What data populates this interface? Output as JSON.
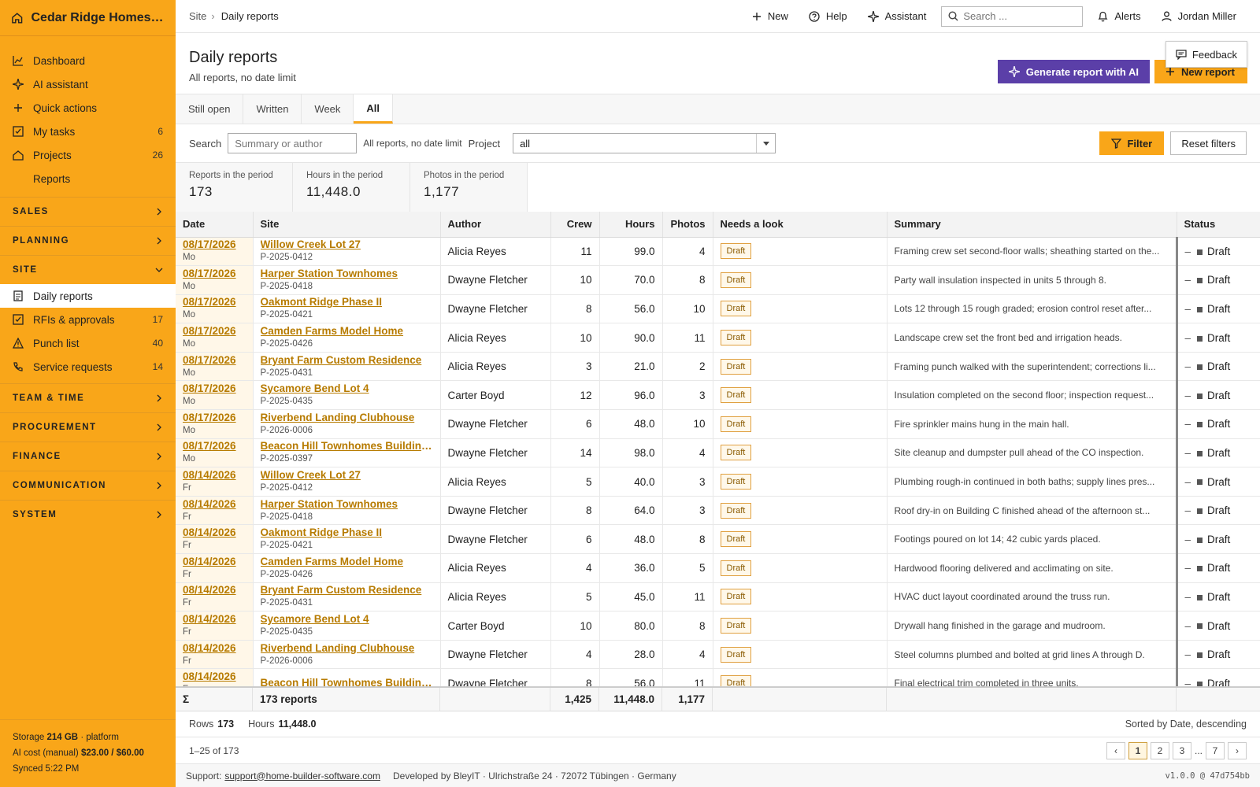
{
  "brand": {
    "name": "Cedar Ridge Homes LLC"
  },
  "nav": [
    {
      "label": "Dashboard",
      "count": "",
      "icon": "chart-icon"
    },
    {
      "label": "AI assistant",
      "count": "",
      "icon": "sparkle-icon"
    },
    {
      "label": "Quick actions",
      "count": "",
      "icon": "plus-icon"
    },
    {
      "label": "My tasks",
      "count": "6",
      "icon": "checkbox-icon"
    },
    {
      "label": "Projects",
      "count": "26",
      "icon": "house-icon"
    },
    {
      "label": "Reports",
      "count": "",
      "icon": "none"
    }
  ],
  "sections": {
    "sales": "SALES",
    "planning": "PLANNING",
    "site": "SITE",
    "team": "TEAM & TIME",
    "procurement": "PROCUREMENT",
    "finance": "FINANCE",
    "communication": "COMMUNICATION",
    "system": "SYSTEM"
  },
  "site_items": [
    {
      "label": "Daily reports",
      "count": ""
    },
    {
      "label": "RFIs & approvals",
      "count": "17"
    },
    {
      "label": "Punch list",
      "count": "40"
    },
    {
      "label": "Service requests",
      "count": "14"
    }
  ],
  "sidebar_footer": {
    "storage_label": "Storage",
    "storage_value": "214 GB",
    "storage_suffix": "· platform",
    "ai_label": "AI cost (manual)",
    "ai_value": "$23.00 / $60.00",
    "synced": "Synced 5:22 PM"
  },
  "topbar": {
    "crumb_root": "Site",
    "crumb_sep": "›",
    "crumb_current": "Daily reports",
    "new": "New",
    "help": "Help",
    "assistant": "Assistant",
    "search_placeholder": "Search ...",
    "alerts": "Alerts",
    "user": "Jordan Miller"
  },
  "header": {
    "title": "Daily reports",
    "subtitle": "All reports, no date limit",
    "feedback": "Feedback",
    "generate_ai": "Generate report with AI",
    "new_report": "New report"
  },
  "tabs": [
    "Still open",
    "Written",
    "Week",
    "All"
  ],
  "filters": {
    "search_label": "Search",
    "search_placeholder": "Summary or author",
    "note": "All reports, no date limit",
    "project_label": "Project",
    "project_value": "all",
    "filter_btn": "Filter",
    "reset_btn": "Reset filters"
  },
  "stats": [
    {
      "label": "Reports in the period",
      "value": "173"
    },
    {
      "label": "Hours in the period",
      "value": "11,448.0"
    },
    {
      "label": "Photos in the period",
      "value": "1,177"
    }
  ],
  "columns": [
    "Date",
    "Site",
    "Author",
    "Crew",
    "Hours",
    "Photos",
    "Needs a look",
    "Summary",
    "Status"
  ],
  "rows": [
    {
      "date": "08/17/2026",
      "day": "Mo",
      "site": "Willow Creek Lot 27",
      "code": "P-2025-0412",
      "author": "Alicia Reyes",
      "crew": "11",
      "hours": "99.0",
      "photos": "4",
      "badge": "Draft",
      "summary": "Framing crew set second-floor walls; sheathing started on the...",
      "status": "Draft"
    },
    {
      "date": "08/17/2026",
      "day": "Mo",
      "site": "Harper Station Townhomes",
      "code": "P-2025-0418",
      "author": "Dwayne Fletcher",
      "crew": "10",
      "hours": "70.0",
      "photos": "8",
      "badge": "Draft",
      "summary": "Party wall insulation inspected in units 5 through 8.",
      "status": "Draft"
    },
    {
      "date": "08/17/2026",
      "day": "Mo",
      "site": "Oakmont Ridge Phase II",
      "code": "P-2025-0421",
      "author": "Dwayne Fletcher",
      "crew": "8",
      "hours": "56.0",
      "photos": "10",
      "badge": "Draft",
      "summary": "Lots 12 through 15 rough graded; erosion control reset after...",
      "status": "Draft"
    },
    {
      "date": "08/17/2026",
      "day": "Mo",
      "site": "Camden Farms Model Home",
      "code": "P-2025-0426",
      "author": "Alicia Reyes",
      "crew": "10",
      "hours": "90.0",
      "photos": "11",
      "badge": "Draft",
      "summary": "Landscape crew set the front bed and irrigation heads.",
      "status": "Draft"
    },
    {
      "date": "08/17/2026",
      "day": "Mo",
      "site": "Bryant Farm Custom Residence",
      "code": "P-2025-0431",
      "author": "Alicia Reyes",
      "crew": "3",
      "hours": "21.0",
      "photos": "2",
      "badge": "Draft",
      "summary": "Framing punch walked with the superintendent; corrections li...",
      "status": "Draft"
    },
    {
      "date": "08/17/2026",
      "day": "Mo",
      "site": "Sycamore Bend Lot 4",
      "code": "P-2025-0435",
      "author": "Carter Boyd",
      "crew": "12",
      "hours": "96.0",
      "photos": "3",
      "badge": "Draft",
      "summary": "Insulation completed on the second floor; inspection request...",
      "status": "Draft"
    },
    {
      "date": "08/17/2026",
      "day": "Mo",
      "site": "Riverbend Landing Clubhouse",
      "code": "P-2026-0006",
      "author": "Dwayne Fletcher",
      "crew": "6",
      "hours": "48.0",
      "photos": "10",
      "badge": "Draft",
      "summary": "Fire sprinkler mains hung in the main hall.",
      "status": "Draft"
    },
    {
      "date": "08/17/2026",
      "day": "Mo",
      "site": "Beacon Hill Townhomes Building C",
      "code": "P-2025-0397",
      "author": "Dwayne Fletcher",
      "crew": "14",
      "hours": "98.0",
      "photos": "4",
      "badge": "Draft",
      "summary": "Site cleanup and dumpster pull ahead of the CO inspection.",
      "status": "Draft"
    },
    {
      "date": "08/14/2026",
      "day": "Fr",
      "site": "Willow Creek Lot 27",
      "code": "P-2025-0412",
      "author": "Alicia Reyes",
      "crew": "5",
      "hours": "40.0",
      "photos": "3",
      "badge": "Draft",
      "summary": "Plumbing rough-in continued in both baths; supply lines pres...",
      "status": "Draft"
    },
    {
      "date": "08/14/2026",
      "day": "Fr",
      "site": "Harper Station Townhomes",
      "code": "P-2025-0418",
      "author": "Dwayne Fletcher",
      "crew": "8",
      "hours": "64.0",
      "photos": "3",
      "badge": "Draft",
      "summary": "Roof dry-in on Building C finished ahead of the afternoon st...",
      "status": "Draft"
    },
    {
      "date": "08/14/2026",
      "day": "Fr",
      "site": "Oakmont Ridge Phase II",
      "code": "P-2025-0421",
      "author": "Dwayne Fletcher",
      "crew": "6",
      "hours": "48.0",
      "photos": "8",
      "badge": "Draft",
      "summary": "Footings poured on lot 14; 42 cubic yards placed.",
      "status": "Draft"
    },
    {
      "date": "08/14/2026",
      "day": "Fr",
      "site": "Camden Farms Model Home",
      "code": "P-2025-0426",
      "author": "Alicia Reyes",
      "crew": "4",
      "hours": "36.0",
      "photos": "5",
      "badge": "Draft",
      "summary": "Hardwood flooring delivered and acclimating on site.",
      "status": "Draft"
    },
    {
      "date": "08/14/2026",
      "day": "Fr",
      "site": "Bryant Farm Custom Residence",
      "code": "P-2025-0431",
      "author": "Alicia Reyes",
      "crew": "5",
      "hours": "45.0",
      "photos": "11",
      "badge": "Draft",
      "summary": "HVAC duct layout coordinated around the truss run.",
      "status": "Draft"
    },
    {
      "date": "08/14/2026",
      "day": "Fr",
      "site": "Sycamore Bend Lot 4",
      "code": "P-2025-0435",
      "author": "Carter Boyd",
      "crew": "10",
      "hours": "80.0",
      "photos": "8",
      "badge": "Draft",
      "summary": "Drywall hang finished in the garage and mudroom.",
      "status": "Draft"
    },
    {
      "date": "08/14/2026",
      "day": "Fr",
      "site": "Riverbend Landing Clubhouse",
      "code": "P-2026-0006",
      "author": "Dwayne Fletcher",
      "crew": "4",
      "hours": "28.0",
      "photos": "4",
      "badge": "Draft",
      "summary": "Steel columns plumbed and bolted at grid lines A through D.",
      "status": "Draft"
    },
    {
      "date": "08/14/2026",
      "day": "Fr",
      "site": "Beacon Hill Townhomes Building C",
      "code": "",
      "author": "Dwayne Fletcher",
      "crew": "8",
      "hours": "56.0",
      "photos": "11",
      "badge": "Draft",
      "summary": "Final electrical trim completed in three units.",
      "status": "Draft"
    }
  ],
  "totals": {
    "sigma": "Σ",
    "reports": "173 reports",
    "crew": "1,425",
    "hours": "11,448.0",
    "photos": "1,177"
  },
  "infobar": {
    "rows_label": "Rows",
    "rows_value": "173",
    "hours_label": "Hours",
    "hours_value": "11,448.0",
    "sorted": "Sorted by Date, descending"
  },
  "pager": {
    "range": "1–25 of 173",
    "prev": "‹",
    "pages": [
      "1",
      "2",
      "3"
    ],
    "ellipsis": "...",
    "last": "7",
    "next": "›"
  },
  "footer": {
    "support_label": "Support:",
    "support_email": "support@home-builder-software.com",
    "developer": "Developed by BleyIT · Ulrichstraße 24 · 72072 Tübingen · Germany",
    "version": "v1.0.0 @ 47d754bb"
  },
  "colors": {
    "accent": "#f9a619",
    "ai_button": "#5b3fa8",
    "link": "#b77b00"
  }
}
